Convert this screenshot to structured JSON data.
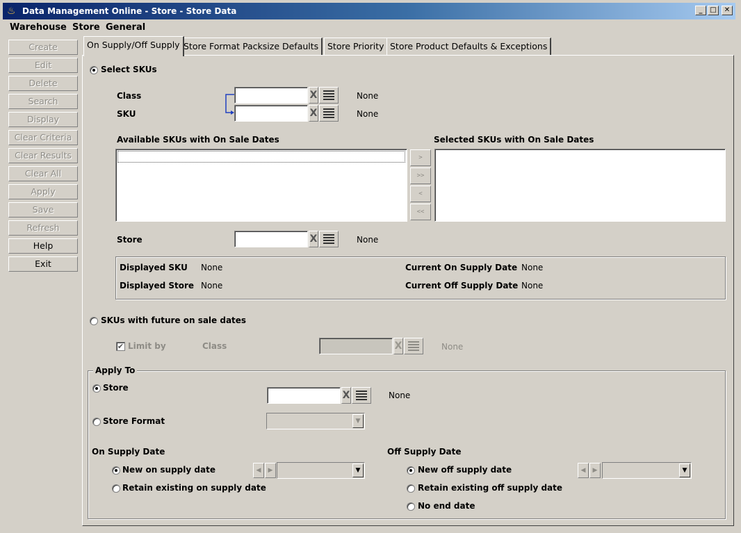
{
  "window": {
    "title": "Data Management Online - Store - Store Data"
  },
  "menu": [
    "Warehouse",
    "Store",
    "General"
  ],
  "sidebar": {
    "buttons": [
      {
        "label": "Create",
        "enabled": false
      },
      {
        "label": "Edit",
        "enabled": false
      },
      {
        "label": "Delete",
        "enabled": false
      },
      {
        "label": "Search",
        "enabled": false
      },
      {
        "label": "Display",
        "enabled": false
      },
      {
        "label": "Clear Criteria",
        "enabled": false
      },
      {
        "label": "Clear Results",
        "enabled": false
      },
      {
        "label": "Clear All",
        "enabled": false
      },
      {
        "label": "Apply",
        "enabled": false
      },
      {
        "label": "Save",
        "enabled": false
      },
      {
        "label": "Refresh",
        "enabled": false
      },
      {
        "label": "Help",
        "enabled": true
      },
      {
        "label": "Exit",
        "enabled": true
      }
    ]
  },
  "tabs": [
    {
      "label": "On Supply/Off Supply",
      "active": true
    },
    {
      "label": "Store Format Packsize Defaults",
      "active": false
    },
    {
      "label": "Store Priority",
      "active": false
    },
    {
      "label": "Store Product Defaults & Exceptions",
      "active": false
    }
  ],
  "select_skus": {
    "radio_label": "Select SKUs",
    "selected": true,
    "class": {
      "label": "Class",
      "value": "",
      "desc": "None"
    },
    "sku": {
      "label": "SKU",
      "value": "",
      "desc": "None"
    },
    "available_label": "Available SKUs with On Sale Dates",
    "selected_label": "Selected SKUs with On Sale Dates",
    "move_buttons": [
      ">",
      ">>",
      "<",
      "<<"
    ],
    "store": {
      "label": "Store",
      "value": "",
      "desc": "None"
    },
    "info": {
      "displayed_sku_label": "Displayed SKU",
      "displayed_sku_value": "None",
      "displayed_store_label": "Displayed Store",
      "displayed_store_value": "None",
      "current_on_label": "Current On Supply Date",
      "current_on_value": "None",
      "current_off_label": "Current Off Supply Date",
      "current_off_value": "None"
    }
  },
  "future": {
    "radio_label": "SKUs with future on sale dates",
    "selected": false,
    "limit_label": "Limit by",
    "limit_checked": true,
    "class_label": "Class",
    "class_value": "",
    "class_desc": "None"
  },
  "apply_to": {
    "title": "Apply To",
    "store_label": "Store",
    "store_value": "",
    "store_desc": "None",
    "store_format_label": "Store Format",
    "on_supply_title": "On Supply Date",
    "on_new_label": "New on supply date",
    "on_retain_label": "Retain existing on supply date",
    "off_supply_title": "Off Supply Date",
    "off_new_label": "New off supply date",
    "off_retain_label": "Retain existing off supply date",
    "off_no_end_label": "No end date"
  },
  "icons": {
    "clear": "X",
    "list": "list-icon",
    "dropdown": "▼",
    "left": "◀",
    "right": "▶"
  }
}
